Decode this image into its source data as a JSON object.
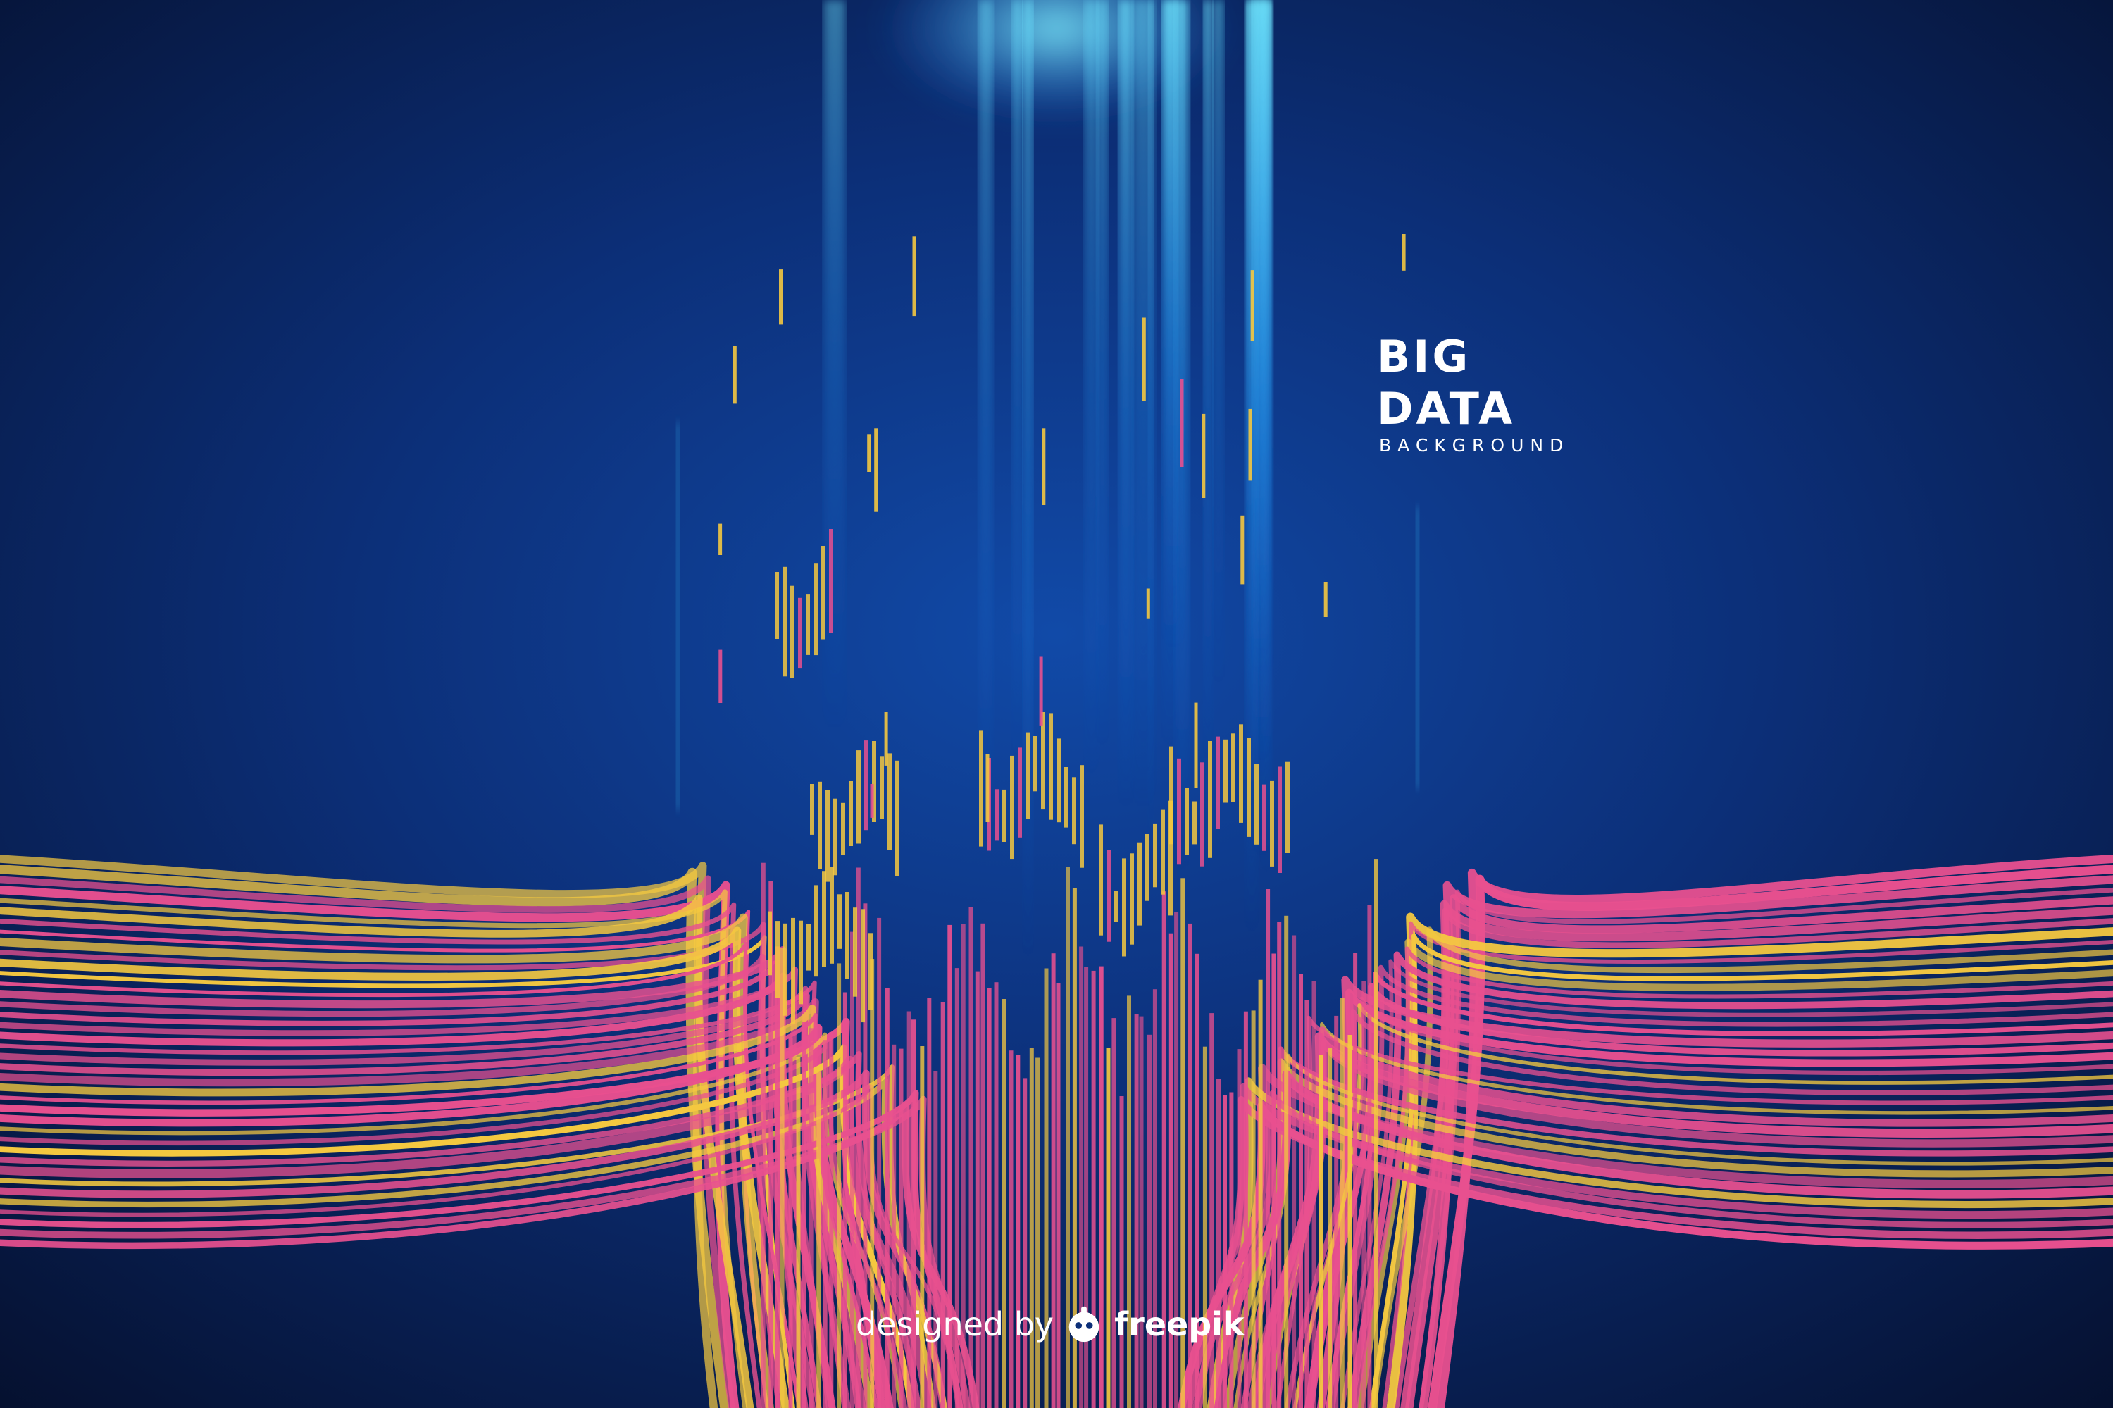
{
  "headline": {
    "line1": "BIG",
    "line2": "DATA",
    "subtitle": "BACKGROUND"
  },
  "credit": {
    "prefix": "designed by",
    "brand": "freepik",
    "logo_icon": "freepik-logo-icon"
  },
  "colors": {
    "background_top": "#071338",
    "background_mid": "#0f3a8a",
    "light_beam": "#38c8ff",
    "stream_pink": "#e8508f",
    "stream_yellow": "#f4c840",
    "text": "#ffffff"
  }
}
